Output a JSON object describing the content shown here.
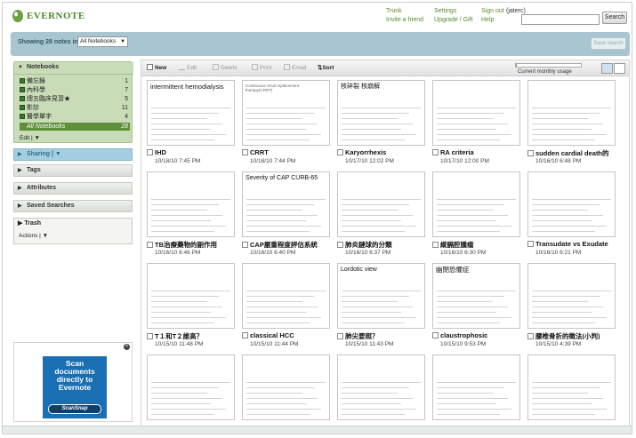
{
  "header": {
    "logo_text": "EVERNOTE",
    "links_col1": [
      "Trunk",
      "Invite a friend"
    ],
    "links_col2": [
      "Settings",
      "Upgrade / Gift"
    ],
    "signout": "Sign out",
    "username": "(jaterc)",
    "help": "Help",
    "search_label": "Search"
  },
  "bluebar": {
    "showing": "Showing 28 notes in",
    "notebook_select": "All Notebooks",
    "save_search": "Save search"
  },
  "sidebar": {
    "notebooks_title": "Notebooks",
    "notebooks": [
      {
        "label": "備忘錄",
        "count": "1"
      },
      {
        "label": "內科學",
        "count": "7"
      },
      {
        "label": "總五臨床見習★",
        "count": "5"
      },
      {
        "label": "影診",
        "count": "11"
      },
      {
        "label": "醫學單字",
        "count": "4"
      }
    ],
    "all_notebooks": {
      "label": "All Notebooks",
      "count": "28"
    },
    "edit": "Edit",
    "sharing": "Sharing",
    "tags": "Tags",
    "attributes": "Attributes",
    "saved_searches": "Saved Searches",
    "trash": "Trash",
    "actions": "Actions"
  },
  "ad": {
    "text": "Scan documents directly to Evernote",
    "logo": "ScanSnap"
  },
  "toolbar": {
    "new": "New",
    "edit": "Edit",
    "delete": "Delete",
    "print": "Print",
    "email": "Email",
    "sort": "Sort",
    "usage_label": "Current monthly usage",
    "usage_fraction": 0.02
  },
  "notes": [
    {
      "title": "IHD",
      "date": "10/18/10 7:45 PM",
      "preview": "intermittent hemodialysis",
      "big": true
    },
    {
      "title": "CRRT",
      "date": "10/18/10 7:44 PM",
      "preview": "Continuous renal replacement therapy(CRRT)",
      "big": false
    },
    {
      "title": "Karyorrhexis",
      "date": "10/17/10 12:02 PM",
      "preview": "核碎裂 核崩解",
      "big": false
    },
    {
      "title": "RA criteria",
      "date": "10/17/10 12:00 PM",
      "preview": "",
      "big": false
    },
    {
      "title": "sudden cardial death的",
      "date": "10/16/10 6:48 PM",
      "preview": "",
      "big": false
    },
    {
      "title": "TB治療藥物的副作用",
      "date": "10/16/10 6:46 PM",
      "preview": "",
      "big": false
    },
    {
      "title": "CAP嚴重程度評估系統",
      "date": "10/16/10 6:40 PM",
      "preview": "Severity of CAP CURB-65",
      "big": false
    },
    {
      "title": "肺炎鏈球的分類",
      "date": "10/16/10 6:37 PM",
      "preview": "",
      "big": false
    },
    {
      "title": "縱膈腔腫瘤",
      "date": "10/16/10 6:30 PM",
      "preview": "",
      "big": false
    },
    {
      "title": "Transudate vs Exudate",
      "date": "10/16/10 6:21 PM",
      "preview": "",
      "big": false
    },
    {
      "title": "T１和T２誰高？",
      "date": "10/15/10 11:48 PM",
      "preview": "",
      "big": false
    },
    {
      "title": "classical HCC",
      "date": "10/15/10 11:44 PM",
      "preview": "",
      "big": false
    },
    {
      "title": "肺尖要照？",
      "date": "10/15/10 11:43 PM",
      "preview": "Lordotic view",
      "big": false
    },
    {
      "title": "claustrophosic",
      "date": "10/15/10 9:53 PM",
      "preview": "幽閉恐懼症",
      "big": true
    },
    {
      "title": "腰椎骨折的徵法(小判)",
      "date": "10/15/10 4:39 PM",
      "preview": "",
      "big": false
    },
    {
      "title": "",
      "date": "",
      "preview": "",
      "big": false
    },
    {
      "title": "",
      "date": "",
      "preview": "",
      "big": false
    },
    {
      "title": "",
      "date": "",
      "preview": "",
      "big": false
    },
    {
      "title": "",
      "date": "",
      "preview": "",
      "big": false
    },
    {
      "title": "",
      "date": "",
      "preview": "",
      "big": false
    }
  ],
  "colors": {
    "brand_green": "#4c8a2e",
    "notebook_panel": "#c9dcb8",
    "selected_notebook": "#5f8f3a",
    "bluebar": "#a9c5cf",
    "sharing": "#a4cfe0"
  }
}
